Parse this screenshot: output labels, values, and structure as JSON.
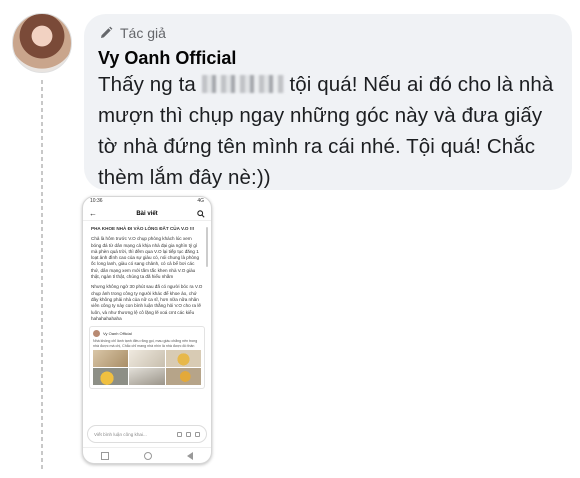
{
  "comment": {
    "badge_label": "Tác giả",
    "author": "Vy Oanh Official",
    "text_before_blur": "Thấy ng ta",
    "text_after_blur": "tội quá! Nếu ai đó cho là nhà mượn thì chụp ngay những góc này và đưa giấy tờ nhà đứng tên mình ra cái nhé. Tội quá! Chắc thèm lắm đây nè:))"
  },
  "attachment": {
    "status_time": "10:36",
    "status_right": "4G",
    "header_title": "Bài viết",
    "headline": "PHA KHOE NHÀ ĐI VÀO LÒNG ĐẤT CỦA V.O !!!",
    "paragraphs": [
      "Chả là hôm trước V.O chụp phòng khách lúc xem bóng đá từ dân mạng cả khịa nhà đại gia nghìn tỷ gì mà phèn quá trời, thì đêm qua V.O lại tiếp tục đăng 1 loạt ảnh đình cao của sự giàu có, nói chung là phòng ốc long lanh, giàu có sang chảnh, có cả bể bơi các thứ, dân mạng xem mới tấm tắc khen nhà V.O giàu thật, ngàn tỉ thật, chúng ta đã hiểu nhầm",
      "Nhưng không ngờ 30 phút sau đã có người bóc ra V.O chụp ảnh trong công ty người khác để khoe ảo, chứ đây không phải nhà của nữ ca sĩ, hơn nữa nữa nhân viên công ty này con bình luận thẳng hỏi V.O cho ra lẽ luôn, và như thương lệ cô lặng lẽ xoá cmt các kiểu hahahahahaha"
    ],
    "card_author": "Vy Oanh Official",
    "card_text": "Nhà không chỉ lành tạnh điều rằng gọi, mau giàu chẳng nên trong nhà được mà chị, Chắc chỉ mang nhà nhìn là nhà được đó thân thôi chàng ...",
    "input_placeholder": "Viết bình luận công khai..."
  },
  "icons": {
    "badge": "pencil-badge-icon",
    "back": "back-arrow-icon",
    "search": "search-icon"
  }
}
